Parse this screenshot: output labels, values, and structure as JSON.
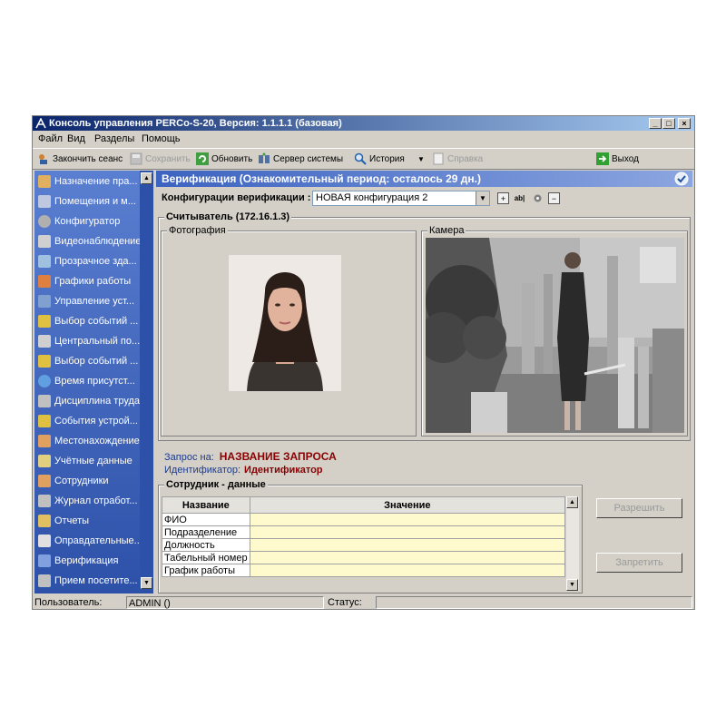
{
  "window": {
    "title": "Консоль управления PERCo-S-20, Версия: 1.1.1.1 (базовая)",
    "controls": [
      "_",
      "□",
      "×"
    ]
  },
  "menu": [
    "Файл",
    "Вид",
    "Разделы",
    "Помощь"
  ],
  "toolbar": {
    "end_session": "Закончить сеанс",
    "save": "Сохранить",
    "refresh": "Обновить",
    "server": "Сервер системы",
    "history": "История",
    "help": "Справка",
    "exit": "Выход"
  },
  "sidebar": {
    "items": [
      {
        "label": "Назначение пра...",
        "icon": "assign-icon",
        "color": "#e0b060"
      },
      {
        "label": "Помещения и м...",
        "icon": "building-icon",
        "color": "#c0c8e0"
      },
      {
        "label": "Конфигуратор",
        "icon": "gear-icon",
        "color": "#b0b0b0"
      },
      {
        "label": "Видеонаблюдение",
        "icon": "camera-icon",
        "color": "#d0d0d0"
      },
      {
        "label": "Прозрачное зда...",
        "icon": "building-glass-icon",
        "color": "#a0c0e0"
      },
      {
        "label": "Графики работы",
        "icon": "schedule-icon",
        "color": "#e08040"
      },
      {
        "label": "Управление уст...",
        "icon": "device-control-icon",
        "color": "#80a0d0"
      },
      {
        "label": "Выбор событий ...",
        "icon": "events-icon",
        "color": "#e0c040"
      },
      {
        "label": "Центральный по...",
        "icon": "guard-icon",
        "color": "#d0d0d0"
      },
      {
        "label": "Выбор событий ...",
        "icon": "events-icon",
        "color": "#e0c040"
      },
      {
        "label": "Время присутст...",
        "icon": "clock-icon",
        "color": "#60a0e0"
      },
      {
        "label": "Дисциплина труда",
        "icon": "discipline-icon",
        "color": "#c0c0c0"
      },
      {
        "label": "События устрой...",
        "icon": "device-events-icon",
        "color": "#e0c040"
      },
      {
        "label": "Местонахождение",
        "icon": "location-icon",
        "color": "#e0a060"
      },
      {
        "label": "Учётные данные",
        "icon": "credentials-icon",
        "color": "#e0d080"
      },
      {
        "label": "Сотрудники",
        "icon": "employees-icon",
        "color": "#e0a060"
      },
      {
        "label": "Журнал отработ...",
        "icon": "journal-icon",
        "color": "#c0c0c0"
      },
      {
        "label": "Отчеты",
        "icon": "reports-icon",
        "color": "#e0c060"
      },
      {
        "label": "Оправдательные...",
        "icon": "documents-icon",
        "color": "#e0e0e0"
      },
      {
        "label": "Верификация",
        "icon": "verification-icon",
        "color": "#80a0e0"
      },
      {
        "label": "Прием посетите...",
        "icon": "visitor-icon",
        "color": "#c0c0c0"
      }
    ]
  },
  "panel": {
    "header": "Верификация (Ознакомительный период: осталось 29 дн.)",
    "config_label": "Конфигурации верификации :",
    "config_value": "НОВАЯ конфигурация 2",
    "reader_group": "Считыватель (172.16.1.3)",
    "photo_group": "Фотография",
    "camera_group": "Камера",
    "request_label": "Запрос на:",
    "request_value": "НАЗВАНИЕ ЗАПРОСА",
    "identifier_label": "Идентификатор:",
    "identifier_value": "Идентификатор",
    "employee_group": "Сотрудник - данные",
    "table": {
      "columns": [
        "Название",
        "Значение"
      ],
      "rows": [
        {
          "name": "ФИО",
          "value": ""
        },
        {
          "name": "Подразделение",
          "value": ""
        },
        {
          "name": "Должность",
          "value": ""
        },
        {
          "name": "Табельный номер",
          "value": ""
        },
        {
          "name": "График работы",
          "value": ""
        }
      ]
    },
    "allow_button": "Разрешить",
    "deny_button": "Запретить"
  },
  "status": {
    "user_label": "Пользователь:",
    "user_value": "ADMIN ()",
    "status_label": "Статус:",
    "status_value": ""
  }
}
